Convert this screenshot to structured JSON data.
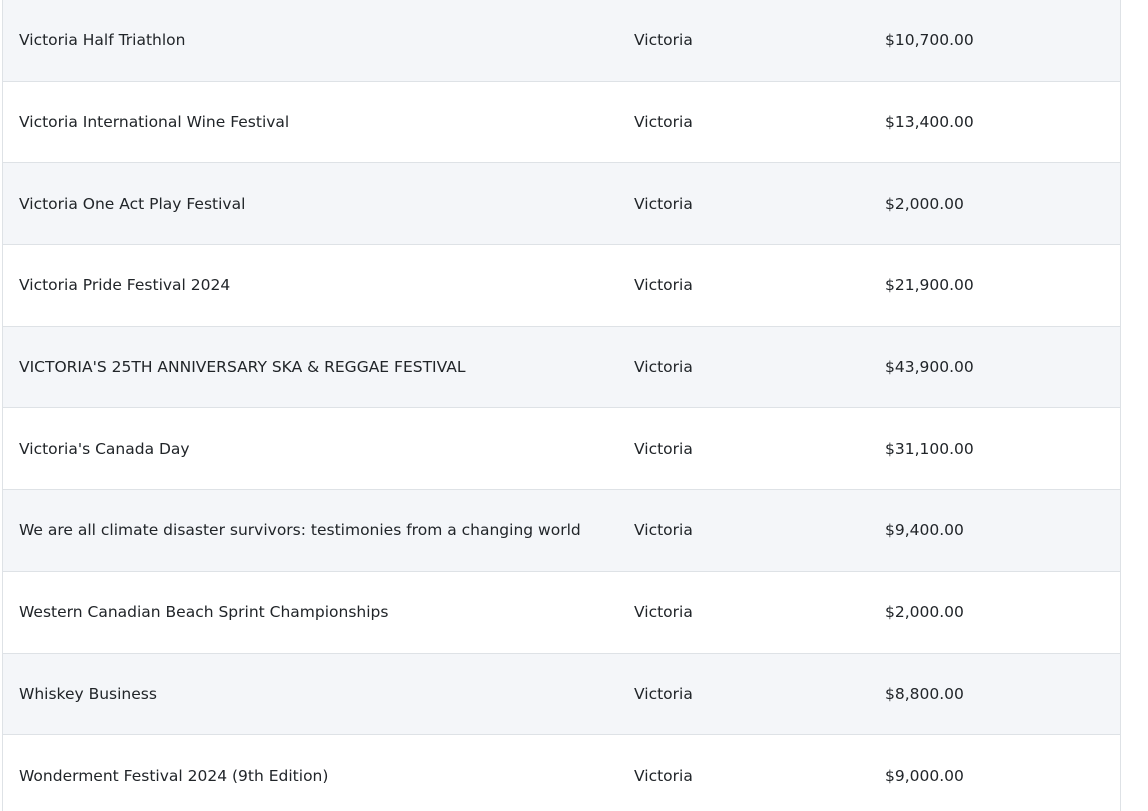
{
  "table": {
    "rows": [
      {
        "name": "Victoria Half Triathlon",
        "city": "Victoria",
        "amount": "$10,700.00"
      },
      {
        "name": "Victoria International Wine Festival",
        "city": "Victoria",
        "amount": "$13,400.00"
      },
      {
        "name": "Victoria One Act Play Festival",
        "city": "Victoria",
        "amount": "$2,000.00"
      },
      {
        "name": "Victoria Pride Festival 2024",
        "city": "Victoria",
        "amount": "$21,900.00"
      },
      {
        "name": "VICTORIA'S 25TH ANNIVERSARY SKA & REGGAE FESTIVAL",
        "city": "Victoria",
        "amount": "$43,900.00"
      },
      {
        "name": "Victoria's Canada Day",
        "city": "Victoria",
        "amount": "$31,100.00"
      },
      {
        "name": "We are all climate disaster survivors: testimonies from a changing world",
        "city": "Victoria",
        "amount": "$9,400.00"
      },
      {
        "name": "Western Canadian Beach Sprint Championships",
        "city": "Victoria",
        "amount": "$2,000.00"
      },
      {
        "name": "Whiskey Business",
        "city": "Victoria",
        "amount": "$8,800.00"
      },
      {
        "name": "Wonderment Festival 2024 (9th Edition)",
        "city": "Victoria",
        "amount": "$9,000.00"
      }
    ]
  }
}
